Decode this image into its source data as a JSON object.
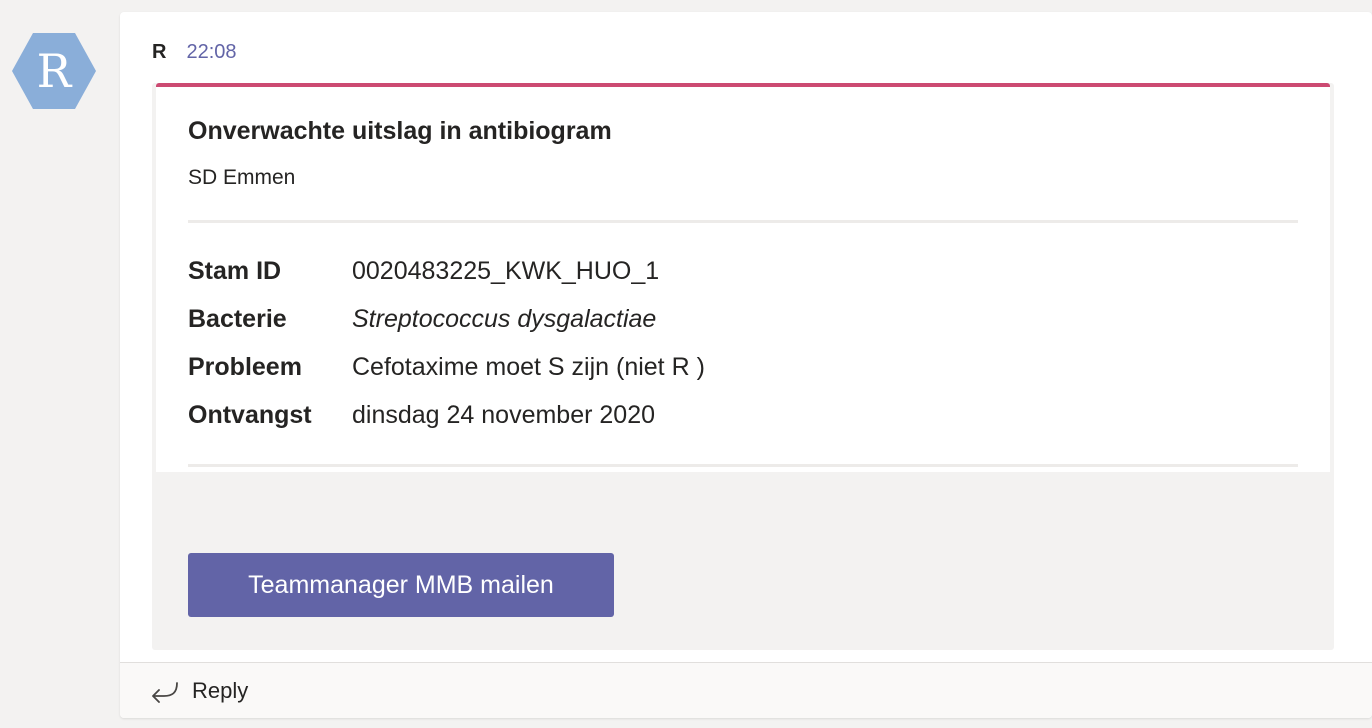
{
  "avatar": {
    "initial": "R",
    "color": "#8aaed9"
  },
  "message": {
    "sender": "R",
    "time": "22:08"
  },
  "card": {
    "accent_color": "#cc4a72",
    "title": "Onverwachte uitslag in antibiogram",
    "subtitle": "SD Emmen",
    "facts": [
      {
        "label": "Stam ID",
        "value": "0020483225_KWK_HUO_1"
      },
      {
        "label": "Bacterie",
        "value": "Streptococcus dysgalactiae"
      },
      {
        "label": "Probleem",
        "value": "Cefotaxime moet S zijn (niet R )"
      },
      {
        "label": "Ontvangst",
        "value": "dinsdag 24 november 2020"
      }
    ],
    "action": {
      "label": "Teammanager MMB mailen",
      "color": "#6264a7"
    }
  },
  "reply": {
    "icon": "reply-arrow-icon",
    "label": "Reply"
  }
}
